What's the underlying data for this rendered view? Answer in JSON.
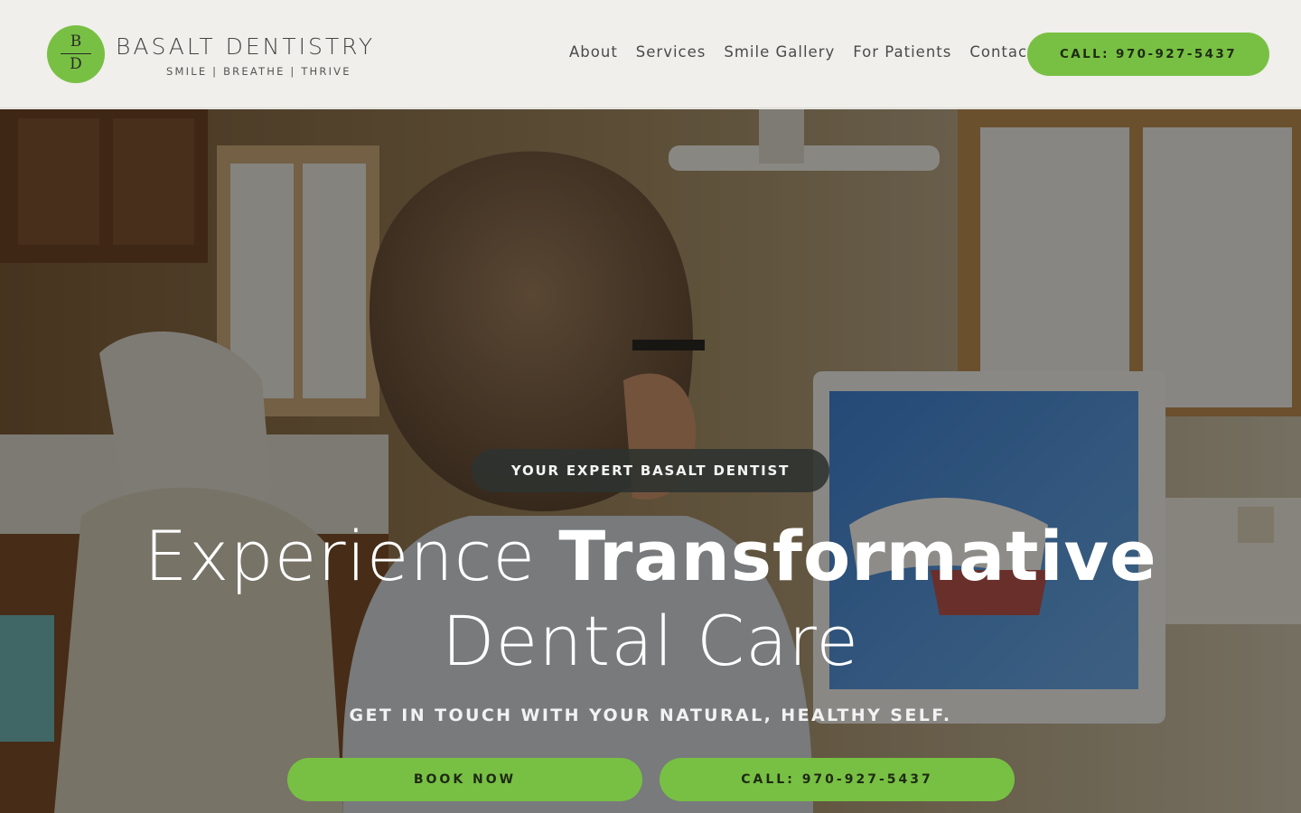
{
  "brand": {
    "logo_top_letter": "B",
    "logo_bottom_letter": "D",
    "name": "BASALT DENTISTRY",
    "tagline": "SMILE | BREATHE | THRIVE",
    "accent_color": "#78c043"
  },
  "nav": {
    "items": [
      {
        "label": "About"
      },
      {
        "label": "Services"
      },
      {
        "label": "Smile Gallery"
      },
      {
        "label": "For Patients"
      },
      {
        "label": "Contact"
      }
    ],
    "call_label": "CALL: 970-927-5437"
  },
  "hero": {
    "eyebrow": "YOUR EXPERT BASALT DENTIST",
    "headline_light": "Experience ",
    "headline_bold": "Transformative",
    "headline_line2": "Dental Care",
    "subheadline": "GET IN TOUCH WITH YOUR NATURAL, HEALTHY SELF.",
    "book_label": "BOOK NOW",
    "call_label": "CALL: 970-927-5437"
  }
}
